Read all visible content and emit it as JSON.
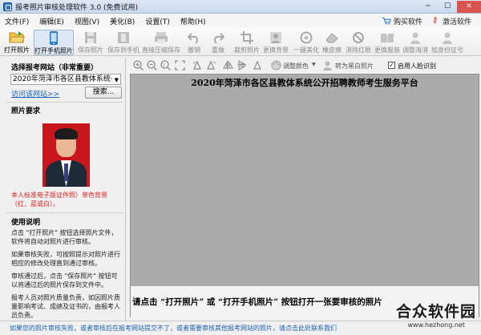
{
  "window": {
    "title": "报考照片审核处理软件 3.0 (免费试用)",
    "min": "─",
    "max": "☐",
    "close": "✕"
  },
  "menu": {
    "items": [
      "文件(F)",
      "编辑(E)",
      "视图(V)",
      "美化(B)",
      "设置(T)",
      "帮助(H)"
    ],
    "buy": "购买软件",
    "activate": "激活软件"
  },
  "toolbar": {
    "items": [
      {
        "label": "打开照片",
        "icon": "folder-open-icon"
      },
      {
        "label": "打开手机照片",
        "icon": "phone-icon"
      },
      {
        "label": "保存照片",
        "icon": "save-icon"
      },
      {
        "label": "保存到手机",
        "icon": "save-phone-icon"
      },
      {
        "label": "直接压缩保存",
        "icon": "compress-icon"
      },
      {
        "label": "撤销",
        "icon": "undo-icon"
      },
      {
        "label": "重做",
        "icon": "redo-icon"
      },
      {
        "label": "裁剪照片",
        "icon": "crop-icon"
      },
      {
        "label": "更换背景",
        "icon": "background-icon"
      },
      {
        "label": "一键美化",
        "icon": "beautify-icon"
      },
      {
        "label": "橡皮擦",
        "icon": "eraser-icon"
      },
      {
        "label": "消除红眼",
        "icon": "redeye-icon"
      },
      {
        "label": "更换服装",
        "icon": "clothes-icon"
      },
      {
        "label": "调整海消",
        "icon": "adjust-icon"
      },
      {
        "label": "加身份证号",
        "icon": "id-card-icon"
      }
    ]
  },
  "left": {
    "site_title": "选择报考网站（非常重要）",
    "site_selected": "2020年菏泽市各区县教体系统·",
    "visit_link": "访问该网站>>",
    "search_button": "搜索...",
    "photo_title": "照片要求",
    "photo_note": "本人标准电子版证件照）单色背景（红、蓝或白）。",
    "usage_title": "使用说明",
    "usage": [
      "点击 \"打开照片\" 按钮选择照片文件，软件将自动对照片进行审核。",
      "如果审核失败，可按照提示对照片进行相应的修改处理直到通过审核。",
      "审核通过后，点击 \"保存照片\" 按钮可以将通过后的照片保存到文件中。",
      "报考人员对照片质量负责，如因照片质量影响考试、成绩及证书的，由报考人员负责。"
    ]
  },
  "canvas_toolbar": {
    "adjust_color": "调整颜色",
    "to_bw": "转为黑白照片",
    "face_detect": "启用人脸识别",
    "face_detect_checked": "✓"
  },
  "main": {
    "banner": "2020年菏泽市各区县教体系统公开招聘教师考生服务平台",
    "prompt": "请点击 “打开照片” 或 “打开手机照片” 按钮打开一张要审核的照片"
  },
  "status": {
    "text": "如果您的照片审核失败，或者审核后在报考网站提交不了，或者需要审核其他报考网站的照片，请点击此处联系我们"
  },
  "watermark": {
    "title": "合众软件园",
    "url": "www.hezhong.net"
  },
  "colors": {
    "accent": "#1a5fb4",
    "photo_bg": "#c8161d",
    "note_red": "#e02020",
    "canvas": "#ababab"
  }
}
